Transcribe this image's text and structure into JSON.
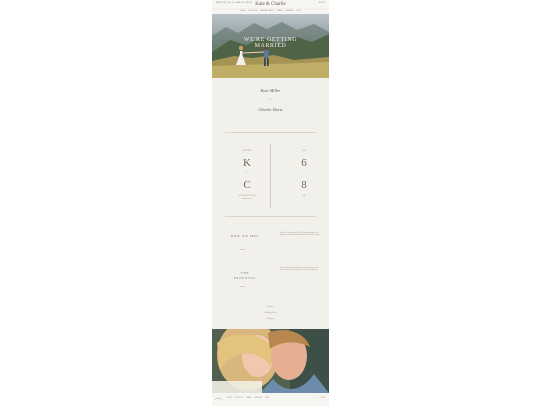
{
  "topbar": {
    "left": "KATE MILLER & CHARLIE DAVIS",
    "right": "RSVP"
  },
  "brand": {
    "name": "Kate & Charlie"
  },
  "nav": {
    "items": [
      "HOME",
      "OUR STORY",
      "WEDDING PARTY",
      "TRAVEL",
      "REGISTRY",
      "RSVP"
    ]
  },
  "hero": {
    "title_line1": "WE'RE GETTING",
    "title_line2": "MARRIED"
  },
  "couple": {
    "bride": "Kate Miller",
    "amp": "&",
    "groom": "Charlie Davis"
  },
  "monogram": {
    "left_top": "SEPTEMBER",
    "left_initial_1": "K",
    "left_mid": "&",
    "left_initial_2": "C",
    "left_bottom": "SONOMA, CALIFORNIA",
    "right_top": "2024",
    "right_num_1": "6",
    "right_mid": "&",
    "right_num_2": "8",
    "right_bottom": "SAT"
  },
  "story": [
    {
      "heading": "HOW WE MET",
      "text": "We met in the summer of 2019 at a friend's wedding in the mountains. Charlie asked Kate to dance and the rest is history."
    },
    {
      "heading": "THE PROPOSAL",
      "text": "On a quiet morning hike at sunrise, Charlie got down on one knee overlooking the valley where we first said I love you."
    }
  ],
  "links": [
    "Our Story",
    "Wedding Party",
    "Registry"
  ],
  "footer": {
    "items": [
      "HOME",
      "OUR STORY",
      "TRAVEL",
      "REGISTRY",
      "RSVP"
    ],
    "copy": "© 2024"
  }
}
